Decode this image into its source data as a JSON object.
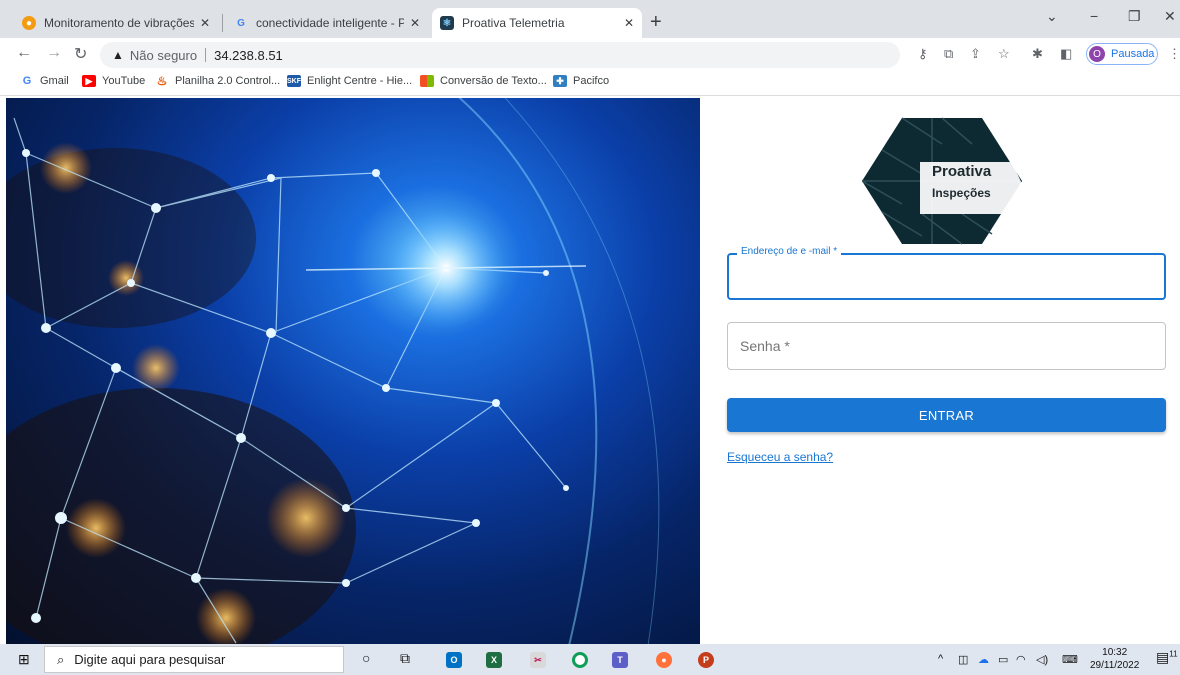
{
  "tabs": [
    {
      "title": "Monitoramento de vibrações intel",
      "active": false
    },
    {
      "title": "conectividade inteligente - Pesqu",
      "active": false
    },
    {
      "title": "Proativa Telemetria",
      "active": true
    }
  ],
  "toolbar": {
    "security_label": "Não seguro",
    "url": "34.238.8.51",
    "profile_initial": "O",
    "profile_status": "Pausada"
  },
  "bookmarks": [
    {
      "label": "Gmail"
    },
    {
      "label": "YouTube"
    },
    {
      "label": "Planilha 2.0 Control..."
    },
    {
      "label": "Enlight Centre - Hie..."
    },
    {
      "label": "Conversão de Texto..."
    },
    {
      "label": "Pacifco"
    }
  ],
  "login": {
    "logo_line1": "Proativa",
    "logo_line2": "Inspeções",
    "email_label": "Endereço de e -mail *",
    "password_placeholder": "Senha *",
    "submit_label": "ENTRAR",
    "forgot_label": "Esqueceu a senha?"
  },
  "taskbar": {
    "search_placeholder": "Digite aqui para pesquisar",
    "time": "10:32",
    "date": "29/11/2022",
    "notifications": "11"
  },
  "colors": {
    "primary": "#1976d2",
    "tabbar": "#dee1e6",
    "taskbar": "#dfe6ef"
  }
}
